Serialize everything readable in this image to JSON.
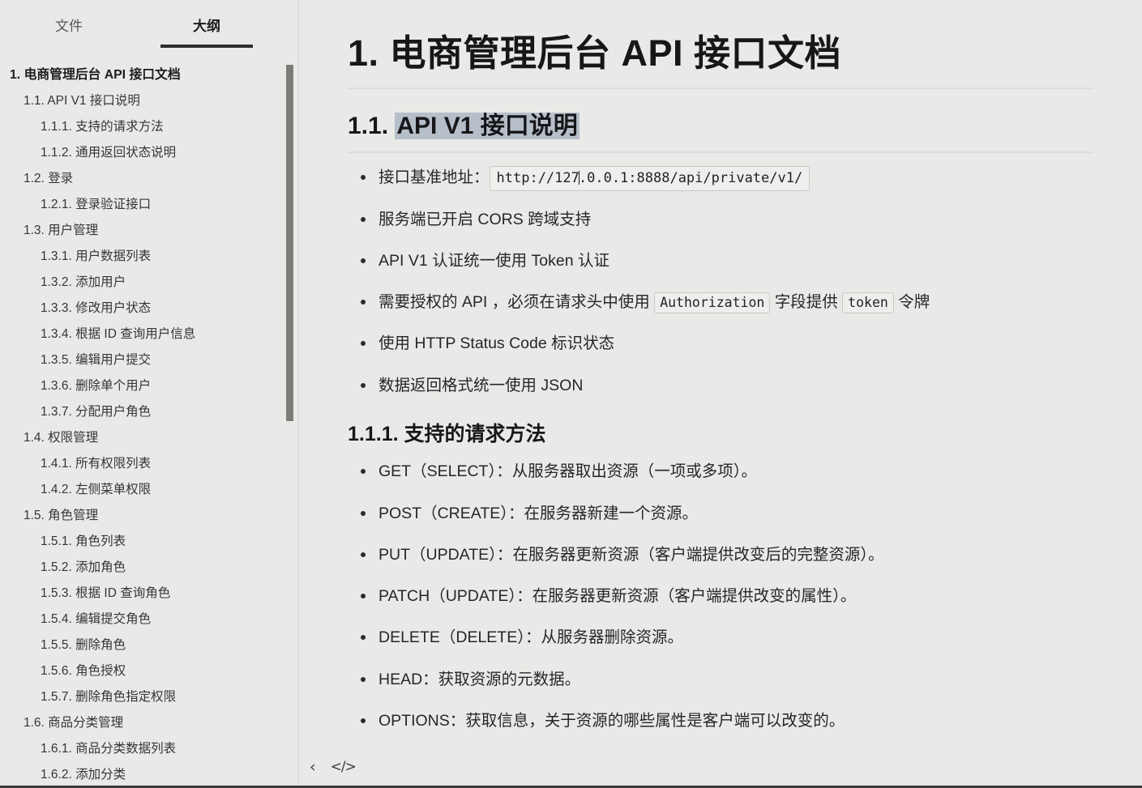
{
  "sidebar": {
    "tabs": [
      {
        "label": "文件",
        "active": false,
        "name": "tab-files"
      },
      {
        "label": "大纲",
        "active": true,
        "name": "tab-outline"
      }
    ],
    "outline": [
      {
        "level": 1,
        "label": "1. 电商管理后台 API 接口文档"
      },
      {
        "level": 2,
        "label": "1.1. API V1 接口说明"
      },
      {
        "level": 3,
        "label": "1.1.1. 支持的请求方法"
      },
      {
        "level": 3,
        "label": "1.1.2. 通用返回状态说明"
      },
      {
        "level": 2,
        "label": "1.2. 登录"
      },
      {
        "level": 3,
        "label": "1.2.1. 登录验证接口"
      },
      {
        "level": 2,
        "label": "1.3. 用户管理"
      },
      {
        "level": 3,
        "label": "1.3.1. 用户数据列表"
      },
      {
        "level": 3,
        "label": "1.3.2. 添加用户"
      },
      {
        "level": 3,
        "label": "1.3.3. 修改用户状态"
      },
      {
        "level": 3,
        "label": "1.3.4. 根据 ID 查询用户信息"
      },
      {
        "level": 3,
        "label": "1.3.5. 编辑用户提交"
      },
      {
        "level": 3,
        "label": "1.3.6. 删除单个用户"
      },
      {
        "level": 3,
        "label": "1.3.7. 分配用户角色"
      },
      {
        "level": 2,
        "label": "1.4. 权限管理"
      },
      {
        "level": 3,
        "label": "1.4.1. 所有权限列表"
      },
      {
        "level": 3,
        "label": "1.4.2. 左侧菜单权限"
      },
      {
        "level": 2,
        "label": "1.5. 角色管理"
      },
      {
        "level": 3,
        "label": "1.5.1. 角色列表"
      },
      {
        "level": 3,
        "label": "1.5.2. 添加角色"
      },
      {
        "level": 3,
        "label": "1.5.3. 根据 ID 查询角色"
      },
      {
        "level": 3,
        "label": "1.5.4. 编辑提交角色"
      },
      {
        "level": 3,
        "label": "1.5.5. 删除角色"
      },
      {
        "level": 3,
        "label": "1.5.6. 角色授权"
      },
      {
        "level": 3,
        "label": "1.5.7. 删除角色指定权限"
      },
      {
        "level": 2,
        "label": "1.6. 商品分类管理"
      },
      {
        "level": 3,
        "label": "1.6.1. 商品分类数据列表"
      },
      {
        "level": 3,
        "label": "1.6.2. 添加分类"
      }
    ]
  },
  "bottom_bar": {
    "back_icon": "‹",
    "source_code_icon": "</>"
  },
  "document": {
    "h1": "1. 电商管理后台 API 接口文档",
    "h2_number": "1.1. ",
    "h2_highlighted": "API V1 接口说明",
    "intro_bullets": {
      "b1_label": "接口基准地址：",
      "b1_code": "http://127.0.0.1:8888/api/private/v1/",
      "b1_code_pre": "http://127",
      "b1_code_post": ".0.0.1:8888/api/private/v1/",
      "b2": "服务端已开启 CORS 跨域支持",
      "b3": "API V1 认证统一使用 Token 认证",
      "b4_pre": "需要授权的 API ，必须在请求头中使用 ",
      "b4_code1": "Authorization",
      "b4_mid": " 字段提供 ",
      "b4_code2": "token",
      "b4_post": " 令牌",
      "b5": "使用 HTTP Status Code 标识状态",
      "b6": "数据返回格式统一使用 JSON"
    },
    "h3": "1.1.1. 支持的请求方法",
    "method_bullets": [
      "GET（SELECT）：从服务器取出资源（一项或多项）。",
      "POST（CREATE）：在服务器新建一个资源。",
      "PUT（UPDATE）：在服务器更新资源（客户端提供改变后的完整资源）。",
      "PATCH（UPDATE）：在服务器更新资源（客户端提供改变的属性）。",
      "DELETE（DELETE）：从服务器删除资源。",
      "HEAD：获取资源的元数据。",
      "OPTIONS：获取信息，关于资源的哪些属性是客户端可以改变的。"
    ]
  },
  "colors": {
    "background": "#e9eae7",
    "highlight": "#b6bfc9",
    "accent_underline": "#2e2e2c",
    "scrollbar": "#7b7d79",
    "rule": "#dcdedb"
  }
}
